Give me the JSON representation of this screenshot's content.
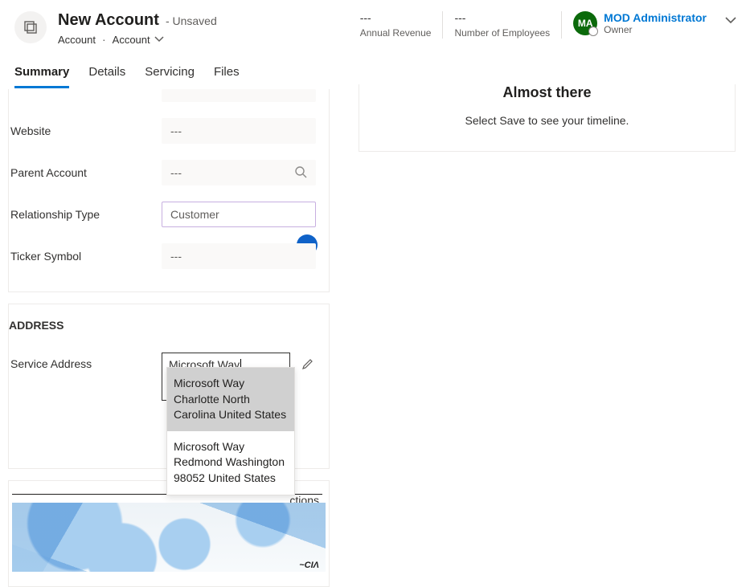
{
  "header": {
    "title": "New Account",
    "status": "- Unsaved",
    "entity": "Account",
    "entity_type": "Account",
    "stats": [
      {
        "value": "---",
        "label": "Annual Revenue"
      },
      {
        "value": "---",
        "label": "Number of Employees"
      }
    ],
    "owner": {
      "initials": "MA",
      "name": "MOD Administrator",
      "role": "Owner"
    }
  },
  "tabs": [
    "Summary",
    "Details",
    "Servicing",
    "Files"
  ],
  "active_tab": "Summary",
  "fields": {
    "website": {
      "label": "Website",
      "value": "---"
    },
    "parent_account": {
      "label": "Parent Account",
      "value": "---"
    },
    "relationship_type": {
      "label": "Relationship Type",
      "placeholder": "Customer"
    },
    "ticker_symbol": {
      "label": "Ticker Symbol",
      "value": "---"
    }
  },
  "address_section": {
    "heading": "ADDRESS",
    "service_address": {
      "label": "Service Address",
      "input_value": "Microsoft Way",
      "suggestions": [
        "Microsoft Way Charlotte North Carolina United States",
        "Microsoft Way Redmond Washington 98052 United States"
      ]
    }
  },
  "map_section": {
    "sections_text": "ctions",
    "map_attribution": "~CΙΛ"
  },
  "timeline": {
    "heading": "Almost there",
    "body": "Select Save to see your timeline."
  }
}
